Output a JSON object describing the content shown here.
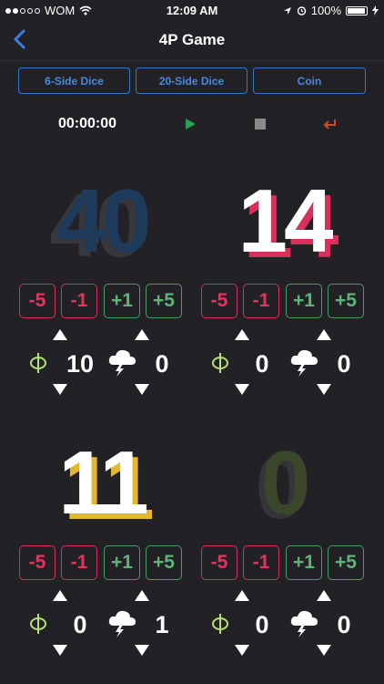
{
  "status_bar": {
    "carrier": "WOM",
    "time": "12:09 AM",
    "battery": "100%"
  },
  "nav": {
    "title": "4P Game",
    "back_icon": "chevron-left-icon"
  },
  "tools": [
    "6-Side Dice",
    "20-Side Dice",
    "Coin"
  ],
  "timer": {
    "value": "00:00:00"
  },
  "players": [
    {
      "life": "40",
      "counter_a": "10",
      "counter_b": "0"
    },
    {
      "life": "14",
      "counter_a": "0",
      "counter_b": "0"
    },
    {
      "life": "11",
      "counter_a": "0",
      "counter_b": "1"
    },
    {
      "life": "0",
      "counter_a": "0",
      "counter_b": "0"
    }
  ],
  "adjust_labels": [
    "-5",
    "-1",
    "+1",
    "+5"
  ],
  "colors": {
    "accent": "#3a74c7",
    "minus": "#e6335e",
    "plus": "#5fb376",
    "play": "#2fa052",
    "stop": "#8a8a8a",
    "undo": "#d9462d"
  }
}
